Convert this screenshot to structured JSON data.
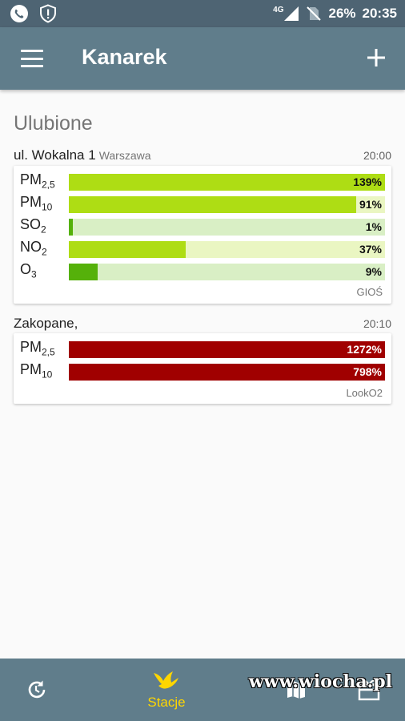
{
  "status_bar": {
    "network": "4G",
    "battery": "26%",
    "time": "20:35",
    "icons": [
      "phone-icon",
      "shield-alert-icon",
      "signal-icon",
      "no-sim-icon",
      "battery-icon"
    ]
  },
  "app_bar": {
    "title": "Kanarek",
    "icons": [
      "menu-icon",
      "add-icon"
    ]
  },
  "section": {
    "title": "Ulubione"
  },
  "stations": [
    {
      "name": "ul. Wokalna 1",
      "city": "Warszawa",
      "time": "20:00",
      "source": "GIOŚ",
      "rows": [
        {
          "param": "PM",
          "sub": "2,5",
          "value": "139%",
          "level": 1.0,
          "fill_color": "#aedd14",
          "track_color": "#eaf6c2"
        },
        {
          "param": "PM",
          "sub": "10",
          "value": "91%",
          "level": 0.91,
          "fill_color": "#aedd14",
          "track_color": "#eaf6c2"
        },
        {
          "param": "SO",
          "sub": "2",
          "value": "1%",
          "level": 0.01,
          "fill_color": "#55b10a",
          "track_color": "#d9efc5"
        },
        {
          "param": "NO",
          "sub": "2",
          "value": "37%",
          "level": 0.37,
          "fill_color": "#aedd14",
          "track_color": "#eaf6c2"
        },
        {
          "param": "O",
          "sub": "3",
          "value": "9%",
          "level": 0.09,
          "fill_color": "#55b10a",
          "track_color": "#d9efc5"
        }
      ]
    },
    {
      "name": "Zakopane,",
      "city": "",
      "time": "20:10",
      "source": "LookO2",
      "rows": [
        {
          "param": "PM",
          "sub": "2,5",
          "value": "1272%",
          "level": 1.0,
          "fill_color": "#a00000",
          "track_color": "#f3c9c9"
        },
        {
          "param": "PM",
          "sub": "10",
          "value": "798%",
          "level": 1.0,
          "fill_color": "#a00000",
          "track_color": "#f3c9c9"
        }
      ]
    }
  ],
  "bottom_nav": {
    "active_label": "Stacje",
    "active_color": "#ffd600",
    "icons": [
      "history-icon",
      "bird-icon",
      "map-icon",
      "gift-icon"
    ]
  },
  "watermark": "www.wiocha.pl"
}
